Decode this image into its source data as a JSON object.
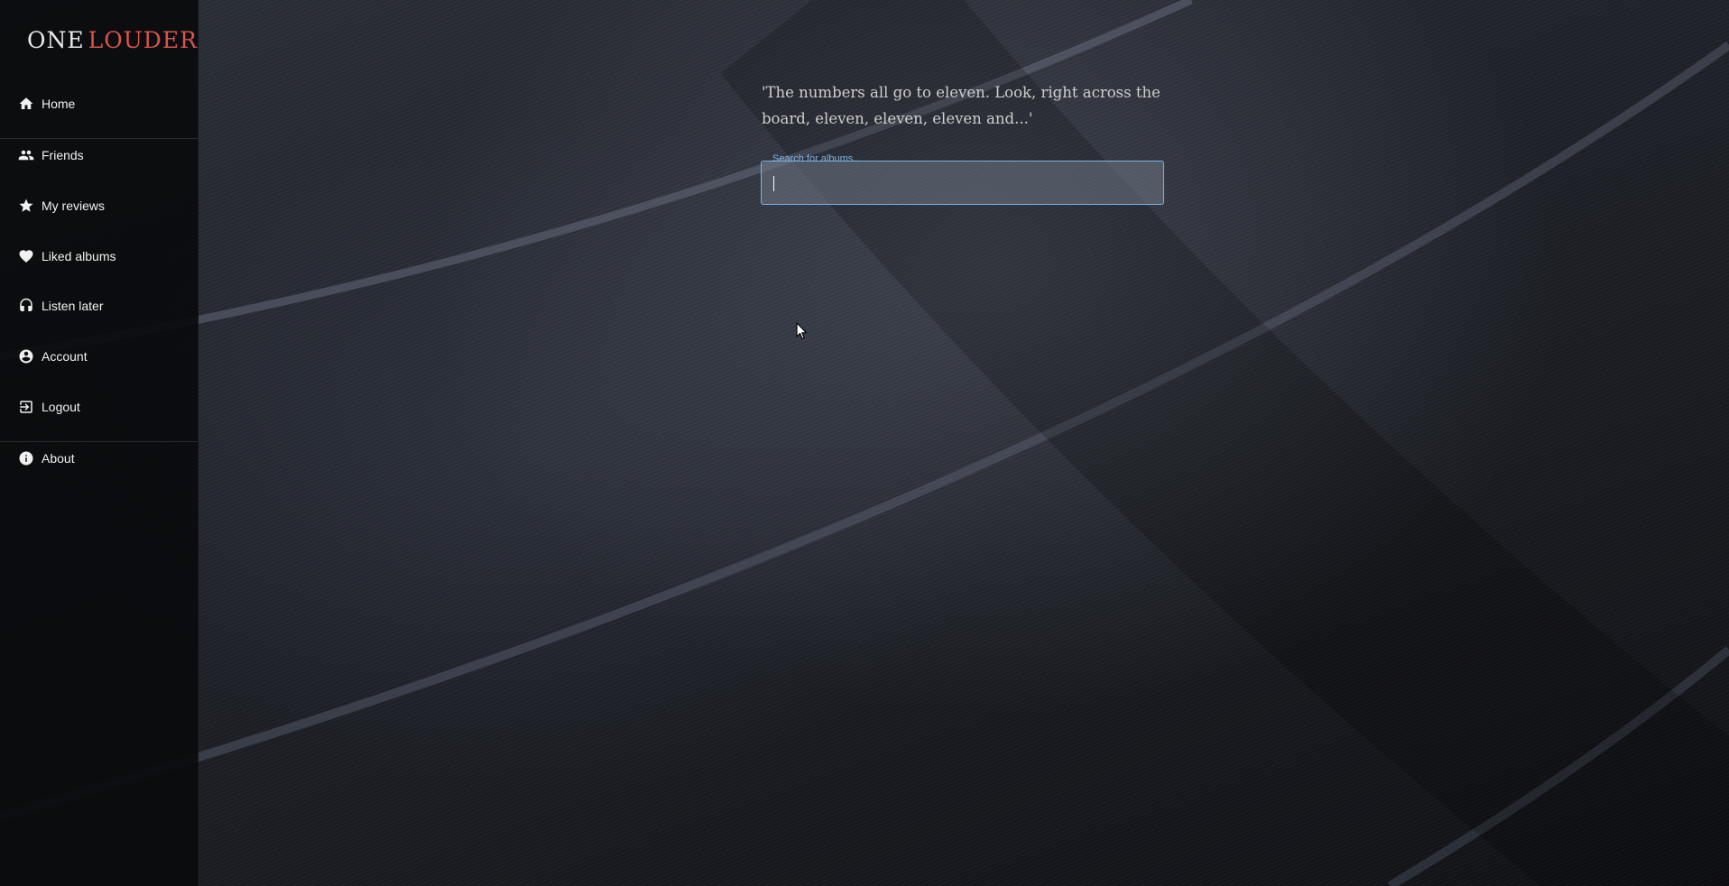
{
  "app": {
    "logo_part1": "ONE",
    "logo_part2": "LOUDER",
    "logo_accent_color": "#d9544d"
  },
  "sidebar": {
    "items": [
      {
        "label": "Home",
        "icon": "home-icon"
      },
      {
        "label": "Friends",
        "icon": "people-icon"
      },
      {
        "label": "My reviews",
        "icon": "star-icon"
      },
      {
        "label": "Liked albums",
        "icon": "heart-icon"
      },
      {
        "label": "Listen later",
        "icon": "headphones-icon"
      },
      {
        "label": "Account",
        "icon": "account-circle-icon"
      },
      {
        "label": "Logout",
        "icon": "logout-icon"
      },
      {
        "label": "About",
        "icon": "info-icon"
      }
    ]
  },
  "main": {
    "quote": "'The numbers all go to eleven. Look, right across the board, eleven, eleven, eleven and...'",
    "search": {
      "label": "Search for albums...",
      "value": "",
      "focus_color": "#7ab4e6"
    }
  }
}
